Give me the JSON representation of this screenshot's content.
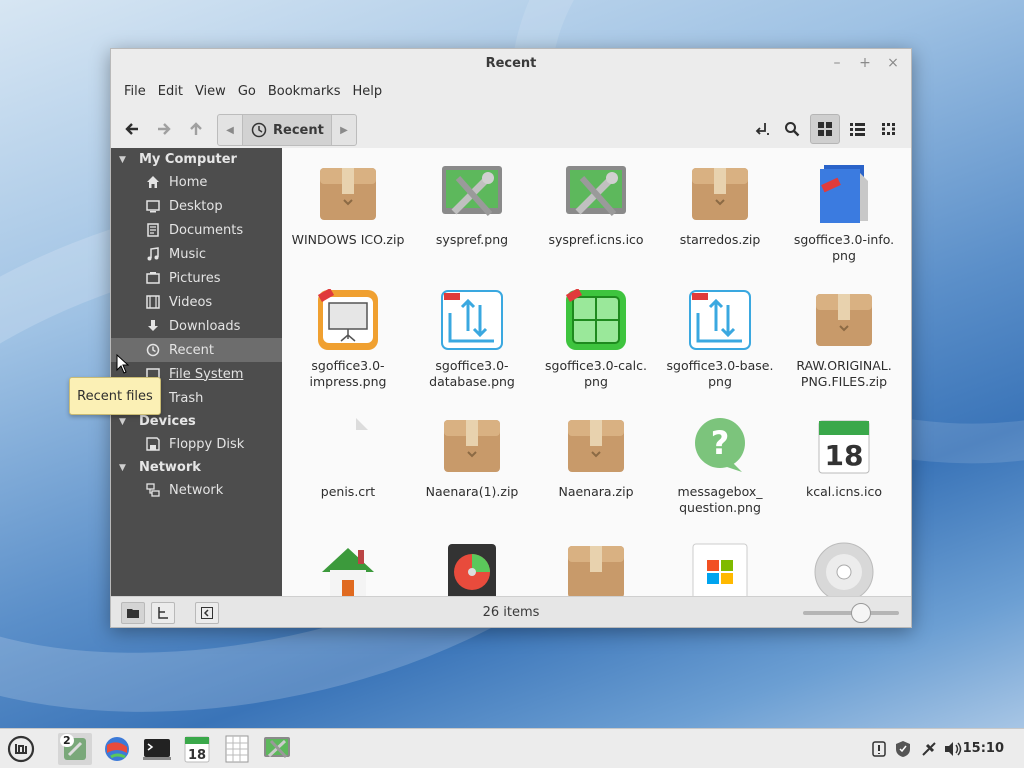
{
  "window": {
    "title": "Recent",
    "controls": {
      "minimize": "–",
      "maximize": "+",
      "close": "×"
    }
  },
  "menubar": [
    "File",
    "Edit",
    "View",
    "Go",
    "Bookmarks",
    "Help"
  ],
  "toolbar": {
    "location": "Recent"
  },
  "sidebar": {
    "sections": [
      {
        "label": "My Computer"
      },
      {
        "label": "Devices"
      },
      {
        "label": "Network"
      }
    ],
    "items": [
      {
        "label": "Home",
        "icon": "home-icon"
      },
      {
        "label": "Desktop",
        "icon": "desktop-icon"
      },
      {
        "label": "Documents",
        "icon": "documents-icon"
      },
      {
        "label": "Music",
        "icon": "music-icon"
      },
      {
        "label": "Pictures",
        "icon": "pictures-icon"
      },
      {
        "label": "Videos",
        "icon": "videos-icon"
      },
      {
        "label": "Downloads",
        "icon": "downloads-icon"
      },
      {
        "label": "Recent",
        "icon": "recent-icon",
        "selected": true
      },
      {
        "label": "File System",
        "icon": "filesystem-icon"
      },
      {
        "label": "Trash",
        "icon": "trash-icon"
      },
      {
        "label": "Floppy Disk",
        "icon": "floppy-icon"
      },
      {
        "label": "Network",
        "icon": "network-icon"
      }
    ]
  },
  "tooltip": "Recent files",
  "files": [
    {
      "name": "WINDOWS ICO.zip",
      "icon": "archive-icon"
    },
    {
      "name": "syspref.png",
      "icon": "system-preferences-icon"
    },
    {
      "name": "syspref.icns.ico",
      "icon": "system-preferences-icon"
    },
    {
      "name": "starredos.zip",
      "icon": "archive-icon"
    },
    {
      "name": "sgoffice3.0-info.png",
      "icon": "sgoffice-info-icon"
    },
    {
      "name": "sgoffice3.0-impress.png",
      "icon": "sgoffice-impress-icon"
    },
    {
      "name": "sgoffice3.0-database.png",
      "icon": "sgoffice-database-icon"
    },
    {
      "name": "sgoffice3.0-calc.png",
      "icon": "sgoffice-calc-icon"
    },
    {
      "name": "sgoffice3.0-base.png",
      "icon": "sgoffice-base-icon"
    },
    {
      "name": "RAW.ORIGINAL.PNG.FILES.zip",
      "icon": "archive-icon"
    },
    {
      "name": "penis.crt",
      "icon": "blank-file-icon"
    },
    {
      "name": "Naenara(1).zip",
      "icon": "archive-icon"
    },
    {
      "name": "Naenara.zip",
      "icon": "archive-icon"
    },
    {
      "name": "messagebox_question.png",
      "icon": "question-bubble-icon"
    },
    {
      "name": "kcal.icns.ico",
      "icon": "calendar-icon"
    },
    {
      "name": "",
      "icon": "house-icon"
    },
    {
      "name": "",
      "icon": "hard-disk-icon"
    },
    {
      "name": "",
      "icon": "archive-icon"
    },
    {
      "name": "",
      "icon": "windows-logo-icon"
    },
    {
      "name": "",
      "icon": "cd-disc-icon"
    }
  ],
  "statusbar": {
    "count": "26 items"
  },
  "taskbar": {
    "workspace_badge": "2",
    "calendar_day": "18",
    "clock": "15:10"
  },
  "file_names_display": [
    [
      "WINDOWS ICO.zip"
    ],
    [
      "syspref.png"
    ],
    [
      "syspref.icns.ico"
    ],
    [
      "starredos.zip"
    ],
    [
      "sgoffice3.0-info.",
      "png"
    ],
    [
      "sgoffice3.0-",
      "impress.png"
    ],
    [
      "sgoffice3.0-",
      "database.png"
    ],
    [
      "sgoffice3.0-calc.",
      "png"
    ],
    [
      "sgoffice3.0-base.",
      "png"
    ],
    [
      "RAW.ORIGINAL.",
      "PNG.FILES.zip"
    ],
    [
      "penis.crt"
    ],
    [
      "Naenara(1).zip"
    ],
    [
      "Naenara.zip"
    ],
    [
      "messagebox_",
      "question.png"
    ],
    [
      "kcal.icns.ico"
    ]
  ]
}
